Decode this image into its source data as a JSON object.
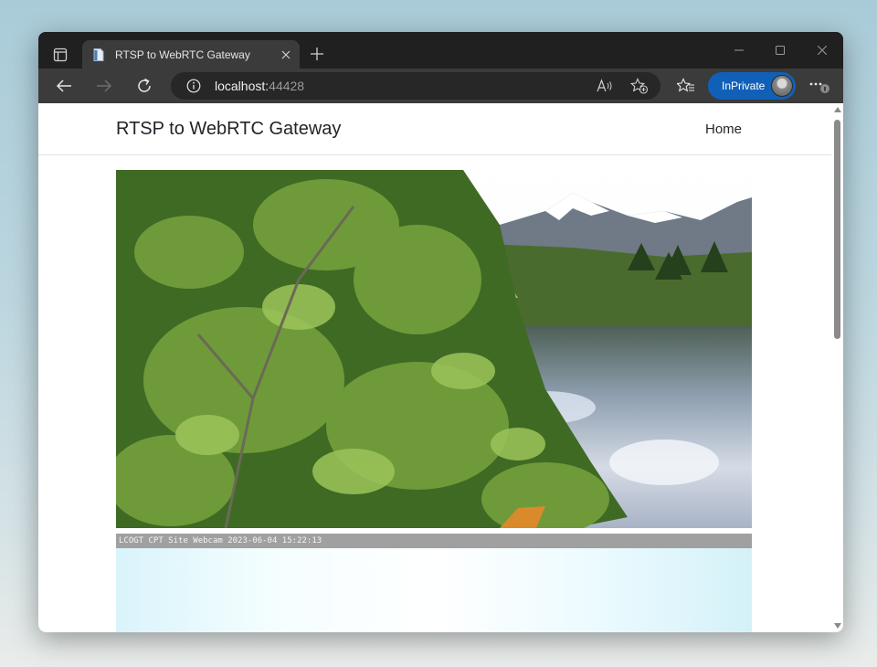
{
  "browser": {
    "tab_title": "RTSP to WebRTC Gateway",
    "url_host": "localhost:",
    "url_port": "44428",
    "inprivate_label": "InPrivate",
    "colors": {
      "chrome": "#202020",
      "toolbar": "#3b3b3b",
      "inprivate": "#1160b8"
    },
    "icons": [
      "tab-actions-icon",
      "page-icon",
      "close-icon",
      "plus-icon",
      "minimize-icon",
      "maximize-icon",
      "window-close-icon",
      "back-icon",
      "forward-icon",
      "refresh-icon",
      "info-icon",
      "read-aloud-icon",
      "add-favorite-icon",
      "favorites-icon",
      "more-icon"
    ]
  },
  "page": {
    "brand": "RTSP to WebRTC Gateway",
    "nav": {
      "home": "Home"
    },
    "videos": [
      {
        "kind": "lake-webcam-stream"
      },
      {
        "kind": "site-webcam-stream",
        "overlay_text": "LCOGT CPT Site Webcam  2023-06-04 15:22:13"
      }
    ]
  }
}
